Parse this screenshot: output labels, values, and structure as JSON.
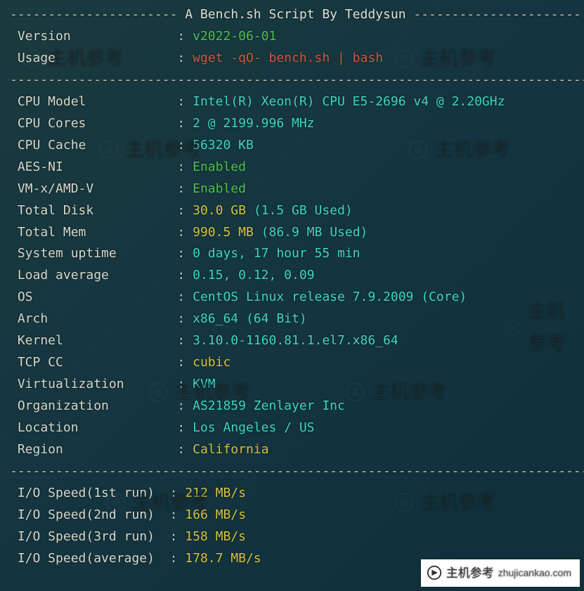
{
  "header": {
    "dash": "----------------------",
    "title": " A Bench.sh Script By Teddysun ",
    "dash2": "----------------------"
  },
  "divider": "-----------------------------------------------------------------------------",
  "rows": {
    "version": {
      "label": "Version",
      "value": "v2022-06-01"
    },
    "usage": {
      "label": "Usage",
      "value": "wget -qO- bench.sh | bash"
    },
    "cpu_model": {
      "label": "CPU Model",
      "value": "Intel(R) Xeon(R) CPU E5-2696 v4 @ 2.20GHz"
    },
    "cpu_cores": {
      "label": "CPU Cores",
      "value": "2 @ 2199.996 MHz"
    },
    "cpu_cache": {
      "label": "CPU Cache",
      "value": "56320 KB"
    },
    "aes_ni": {
      "label": "AES-NI",
      "value": "Enabled"
    },
    "vmx": {
      "label": "VM-x/AMD-V",
      "value": "Enabled"
    },
    "total_disk": {
      "label": "Total Disk",
      "value": "30.0 GB",
      "extra": "(1.5 GB Used)"
    },
    "total_mem": {
      "label": "Total Mem",
      "value": "990.5 MB",
      "extra": "(86.9 MB Used)"
    },
    "uptime": {
      "label": "System uptime",
      "value": "0 days, 17 hour 55 min"
    },
    "load": {
      "label": "Load average",
      "value": "0.15, 0.12, 0.09"
    },
    "os": {
      "label": "OS",
      "value": "CentOS Linux release 7.9.2009 (Core)"
    },
    "arch": {
      "label": "Arch",
      "value": "x86_64 (64 Bit)"
    },
    "kernel": {
      "label": "Kernel",
      "value": "3.10.0-1160.81.1.el7.x86_64"
    },
    "tcp": {
      "label": "TCP CC",
      "value": "cubic"
    },
    "virt": {
      "label": "Virtualization",
      "value": "KVM"
    },
    "org": {
      "label": "Organization",
      "value": "AS21859 Zenlayer Inc"
    },
    "location": {
      "label": "Location",
      "value": "Los Angeles / US"
    },
    "region": {
      "label": "Region",
      "value": "California"
    },
    "io1": {
      "label": "I/O Speed(1st run)",
      "value": "212 MB/s"
    },
    "io2": {
      "label": "I/O Speed(2nd run)",
      "value": "166 MB/s"
    },
    "io3": {
      "label": "I/O Speed(3rd run)",
      "value": "158 MB/s"
    },
    "ioavg": {
      "label": "I/O Speed(average)",
      "value": "178.7 MB/s"
    }
  },
  "watermark": {
    "text": "主机参考",
    "sub": "ZHUJICANKAO.COM"
  },
  "credit": {
    "text": "主机参考",
    "url": "zhujicankao.com"
  }
}
